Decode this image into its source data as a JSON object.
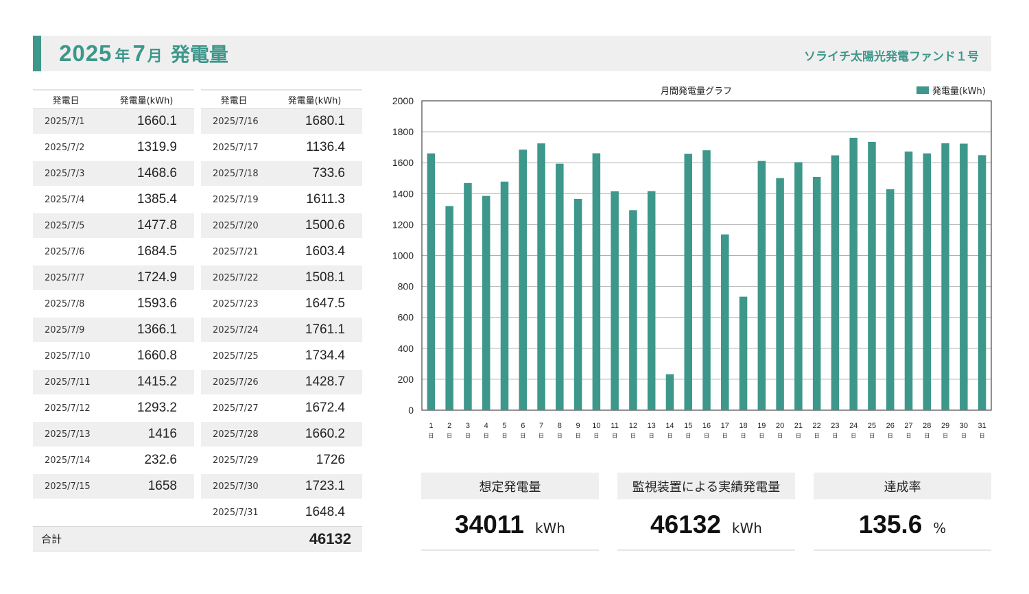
{
  "header": {
    "year": "2025",
    "year_label": "年",
    "month": "7",
    "month_label": "月",
    "label": "発電量",
    "fund_name": "ソライチ太陽光発電ファンド１号"
  },
  "table": {
    "col_date": "発電日",
    "col_value": "発電量(kWh)",
    "left": [
      {
        "date": "2025/7/1",
        "value": "1660.1"
      },
      {
        "date": "2025/7/2",
        "value": "1319.9"
      },
      {
        "date": "2025/7/3",
        "value": "1468.6"
      },
      {
        "date": "2025/7/4",
        "value": "1385.4"
      },
      {
        "date": "2025/7/5",
        "value": "1477.8"
      },
      {
        "date": "2025/7/6",
        "value": "1684.5"
      },
      {
        "date": "2025/7/7",
        "value": "1724.9"
      },
      {
        "date": "2025/7/8",
        "value": "1593.6"
      },
      {
        "date": "2025/7/9",
        "value": "1366.1"
      },
      {
        "date": "2025/7/10",
        "value": "1660.8"
      },
      {
        "date": "2025/7/11",
        "value": "1415.2"
      },
      {
        "date": "2025/7/12",
        "value": "1293.2"
      },
      {
        "date": "2025/7/13",
        "value": "1416"
      },
      {
        "date": "2025/7/14",
        "value": "232.6"
      },
      {
        "date": "2025/7/15",
        "value": "1658"
      }
    ],
    "right": [
      {
        "date": "2025/7/16",
        "value": "1680.1"
      },
      {
        "date": "2025/7/17",
        "value": "1136.4"
      },
      {
        "date": "2025/7/18",
        "value": "733.6"
      },
      {
        "date": "2025/7/19",
        "value": "1611.3"
      },
      {
        "date": "2025/7/20",
        "value": "1500.6"
      },
      {
        "date": "2025/7/21",
        "value": "1603.4"
      },
      {
        "date": "2025/7/22",
        "value": "1508.1"
      },
      {
        "date": "2025/7/23",
        "value": "1647.5"
      },
      {
        "date": "2025/7/24",
        "value": "1761.1"
      },
      {
        "date": "2025/7/25",
        "value": "1734.4"
      },
      {
        "date": "2025/7/26",
        "value": "1428.7"
      },
      {
        "date": "2025/7/27",
        "value": "1672.4"
      },
      {
        "date": "2025/7/28",
        "value": "1660.2"
      },
      {
        "date": "2025/7/29",
        "value": "1726"
      },
      {
        "date": "2025/7/30",
        "value": "1723.1"
      },
      {
        "date": "2025/7/31",
        "value": "1648.4"
      }
    ],
    "total_label": "合計",
    "total_value": "46132"
  },
  "chart_data": {
    "type": "bar",
    "title": "月間発電量グラフ",
    "series": [
      {
        "name": "発電量(kWh)",
        "values": [
          1660.1,
          1319.9,
          1468.6,
          1385.4,
          1477.8,
          1684.5,
          1724.9,
          1593.6,
          1366.1,
          1660.8,
          1415.2,
          1293.2,
          1416,
          232.6,
          1658,
          1680.1,
          1136.4,
          733.6,
          1611.3,
          1500.6,
          1603.4,
          1508.1,
          1647.5,
          1761.1,
          1734.4,
          1428.7,
          1672.4,
          1660.2,
          1726,
          1723.1,
          1648.4
        ]
      }
    ],
    "categories": [
      "1",
      "2",
      "3",
      "4",
      "5",
      "6",
      "7",
      "8",
      "9",
      "10",
      "11",
      "12",
      "13",
      "14",
      "15",
      "16",
      "17",
      "18",
      "19",
      "20",
      "21",
      "22",
      "23",
      "24",
      "25",
      "26",
      "27",
      "28",
      "29",
      "30",
      "31"
    ],
    "category_suffix": "日",
    "ylim": [
      0,
      2000
    ],
    "yticks": [
      0,
      200,
      400,
      600,
      800,
      1000,
      1200,
      1400,
      1600,
      1800,
      2000
    ],
    "grid": true,
    "legend": "top-right",
    "bar_color": "#3d978b"
  },
  "summary": [
    {
      "label": "想定発電量",
      "value": "34011",
      "unit": "kWh"
    },
    {
      "label": "監視装置による実績発電量",
      "value": "46132",
      "unit": "kWh"
    },
    {
      "label": "達成率",
      "value": "135.6",
      "unit": "%"
    }
  ],
  "colors": {
    "accent": "#3d978b",
    "header_bg": "#efefef"
  }
}
